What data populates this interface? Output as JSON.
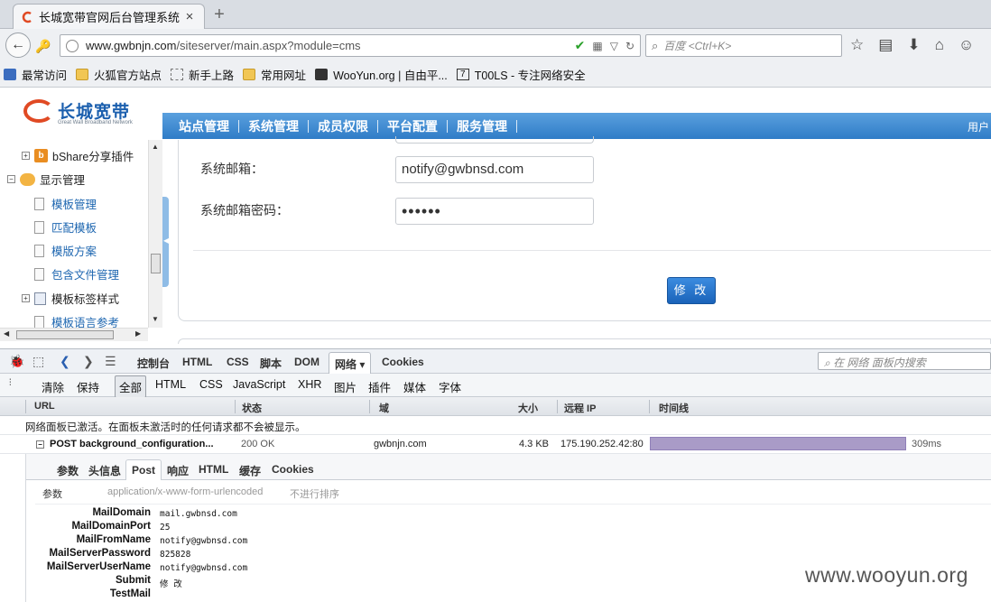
{
  "browser": {
    "tab_title": "长城宽带官网后台管理系统",
    "tab_close": "×",
    "new_tab": "+",
    "url_host": "www.gwbnjn.com",
    "url_path": "/siteserver/main.aspx?module=cms",
    "search_placeholder": "百度 <Ctrl+K>",
    "bookmarks": [
      "最常访问",
      "火狐官方站点",
      "新手上路",
      "常用网址",
      "WooYun.org | 自由平...",
      "T00LS - 专注网络安全"
    ]
  },
  "header": {
    "logo_text": "长城宽带",
    "logo_sub": "Great Wall Broadband Network",
    "menu": [
      "站点管理",
      "系统管理",
      "成员权限",
      "平台配置",
      "服务管理"
    ],
    "user_link": "用户"
  },
  "tree": {
    "items": [
      {
        "label": "bShare分享插件"
      },
      {
        "label": "显示管理"
      },
      {
        "label": "模板管理"
      },
      {
        "label": "匹配模板"
      },
      {
        "label": "模版方案"
      },
      {
        "label": "包含文件管理"
      },
      {
        "label": "模板标签样式"
      },
      {
        "label": "模板语言参考"
      }
    ]
  },
  "form": {
    "email_label": "系统邮箱：",
    "email_value": "notify@gwbnsd.com",
    "password_label": "系统邮箱密码：",
    "password_value": "••••••",
    "submit_label": "修 改"
  },
  "firebug": {
    "tabs": [
      "控制台",
      "HTML",
      "CSS",
      "脚本",
      "DOM",
      "网络 ▾",
      "Cookies"
    ],
    "search_placeholder": "在 网络 面板内搜索",
    "filters": [
      "清除",
      "保持",
      "全部",
      "HTML",
      "CSS",
      "JavaScript",
      "XHR",
      "图片",
      "插件",
      "媒体",
      "字体"
    ],
    "columns": [
      "URL",
      "状态",
      "域",
      "大小",
      "远程 IP",
      "时间线"
    ],
    "notice": "网络面板已激活。在面板未激活时的任何请求都不会被显示。",
    "request": {
      "name": "POST background_configuration...",
      "status": "200 OK",
      "domain": "gwbnjn.com",
      "size": "4.3 KB",
      "remote_ip": "175.190.252.42:80",
      "time": "309ms"
    },
    "detail_tabs": [
      "参数",
      "头信息",
      "Post",
      "响应",
      "HTML",
      "缓存",
      "Cookies"
    ],
    "params_title": "参数",
    "params_type": "application/x-www-form-urlencoded",
    "params_sort": "不进行排序",
    "params": [
      {
        "key": "MailDomain",
        "value": "mail.gwbnsd.com"
      },
      {
        "key": "MailDomainPort",
        "value": "25"
      },
      {
        "key": "MailFromName",
        "value": "notify@gwbnsd.com"
      },
      {
        "key": "MailServerPassword",
        "value": "825828"
      },
      {
        "key": "MailServerUserName",
        "value": "notify@gwbnsd.com"
      },
      {
        "key": "Submit",
        "value": "修 改"
      },
      {
        "key": "TestMail",
        "value": ""
      }
    ]
  },
  "watermark": "www.wooyun.org"
}
